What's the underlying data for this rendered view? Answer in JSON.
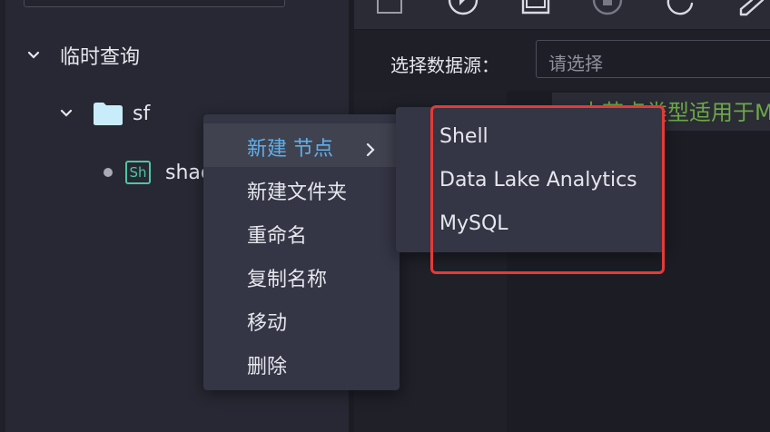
{
  "tree": {
    "root": {
      "label": "临时查询"
    },
    "folder": {
      "label": "sf"
    },
    "node": {
      "badge": "Sh",
      "label": "shad"
    }
  },
  "toolbar": {
    "icons": [
      "stop-square-icon",
      "run-icon",
      "save-icon",
      "stop-circle-icon",
      "refresh-icon",
      "format-pen-icon"
    ]
  },
  "datasource": {
    "label": "选择数据源：",
    "placeholder": "请选择"
  },
  "editor": {
    "code_line": "-- 本节点类型适用于M"
  },
  "context_menu": {
    "items": [
      {
        "label": "新建 节点",
        "has_submenu": true
      },
      {
        "label": "新建文件夹"
      },
      {
        "label": "重命名"
      },
      {
        "label": "复制名称"
      },
      {
        "label": "移动"
      },
      {
        "label": "删除"
      }
    ]
  },
  "submenu": {
    "items": [
      {
        "label": "Shell"
      },
      {
        "label": "Data Lake Analytics"
      },
      {
        "label": "MySQL"
      }
    ]
  },
  "colors": {
    "highlight": "#e53a37",
    "accent": "#5fb0ec",
    "folder": "#c8ecfa",
    "node_badge": "#4fc6a2",
    "code_comment": "#6ca848"
  }
}
